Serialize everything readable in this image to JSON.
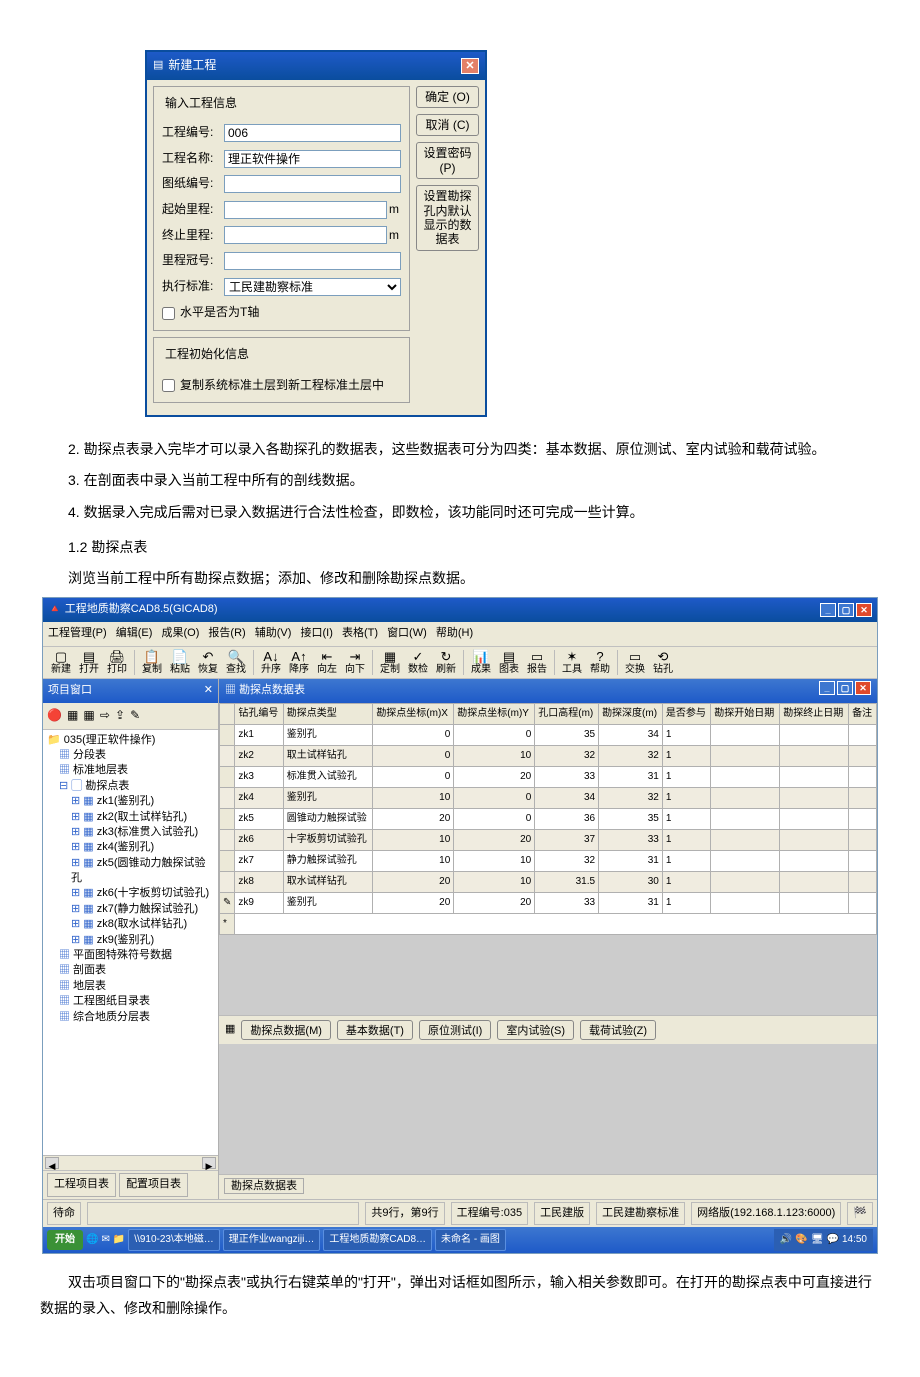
{
  "dialog1": {
    "title": "新建工程",
    "fs1_legend": "输入工程信息",
    "lbl_projId": "工程编号:",
    "val_projId": "006",
    "lbl_projName": "工程名称:",
    "val_projName": "理正软件操作",
    "lbl_drawId": "图纸编号:",
    "lbl_startMile": "起始里程:",
    "unit_m": "m",
    "lbl_endMile": "终止里程:",
    "lbl_mileCode": "里程冠号:",
    "lbl_standard": "执行标准:",
    "val_standard": "工民建勘察标准",
    "chk_horizT": "水平是否为T轴",
    "fs2_legend": "工程初始化信息",
    "chk_copyStd": "复制系统标准土层到新工程标准土层中",
    "btn_ok": "确定 (O)",
    "btn_cancel": "取消 (C)",
    "btn_pwd": "设置密码 (P)",
    "btn_kktbl": "设置勘探孔内默认显示的数据表"
  },
  "body": {
    "p2": "2. 勘探点表录入完毕才可以录入各勘探孔的数据表，这些数据表可分为四类：基本数据、原位测试、室内试验和载荷试验。",
    "p3": "3. 在剖面表中录入当前工程中所有的剖线数据。",
    "p4": "4. 数据录入完成后需对已录入数据进行合法性检查，即数检，该功能同时还可完成一些计算。",
    "h12": "1.2 勘探点表",
    "p_browse": "浏览当前工程中所有勘探点数据；添加、修改和删除勘探点数据。",
    "p_last": "双击项目窗口下的\"勘探点表\"或执行右键菜单的\"打开\"，弹出对话框如图所示，输入相关参数即可。在打开的勘探点表中可直接进行数据的录入、修改和删除操作。"
  },
  "s2": {
    "apptitle": "工程地质勘察CAD8.5(GICAD8)",
    "menu": {
      "m1": "工程管理(P)",
      "m2": "编辑(E)",
      "m3": "成果(O)",
      "m4": "报告(R)",
      "m5": "辅助(V)",
      "m6": "接口(I)",
      "m7": "表格(T)",
      "m8": "窗口(W)",
      "m9": "帮助(H)"
    },
    "toolbar": [
      {
        "ic": "▢",
        "t": "新建"
      },
      {
        "ic": "▤",
        "t": "打开"
      },
      {
        "ic": "🖨",
        "t": "打印"
      },
      {
        "ic": "📋",
        "t": "复制"
      },
      {
        "ic": "📄",
        "t": "粘贴"
      },
      {
        "ic": "↶",
        "t": "恢复"
      },
      {
        "ic": "🔍",
        "t": "查找"
      },
      {
        "ic": "A↓",
        "t": "升序"
      },
      {
        "ic": "A↑",
        "t": "降序"
      },
      {
        "ic": "⇤",
        "t": "向左"
      },
      {
        "ic": "⇥",
        "t": "向下"
      },
      {
        "ic": "▦",
        "t": "定制"
      },
      {
        "ic": "✓",
        "t": "数检"
      },
      {
        "ic": "↻",
        "t": "刷新"
      },
      {
        "ic": "📊",
        "t": "成果"
      },
      {
        "ic": "▤",
        "t": "图表"
      },
      {
        "ic": "▭",
        "t": "报告"
      },
      {
        "ic": "✶",
        "t": "工具"
      },
      {
        "ic": "?",
        "t": "帮助"
      },
      {
        "ic": "▭",
        "t": "交换"
      },
      {
        "ic": "⟲",
        "t": "钻孔"
      }
    ],
    "side_title": "项目窗口",
    "tree_root": "035(理正软件操作)",
    "tree": [
      {
        "ic": "▦",
        "t": "分段表",
        "lvl": 1
      },
      {
        "ic": "▦",
        "t": "标准地层表",
        "lvl": 1
      },
      {
        "ic": "▢",
        "t": "勘探点表",
        "lvl": 1,
        "exp": "⊟"
      },
      {
        "ic": "▦",
        "t": "zk1(鉴别孔)",
        "lvl": 2,
        "exp": "⊞"
      },
      {
        "ic": "▦",
        "t": "zk2(取土试样钻孔)",
        "lvl": 2,
        "exp": "⊞"
      },
      {
        "ic": "▦",
        "t": "zk3(标准贯入试验孔)",
        "lvl": 2,
        "exp": "⊞"
      },
      {
        "ic": "▦",
        "t": "zk4(鉴别孔)",
        "lvl": 2,
        "exp": "⊞"
      },
      {
        "ic": "▦",
        "t": "zk5(圆锥动力触探试验孔",
        "lvl": 2,
        "exp": "⊞"
      },
      {
        "ic": "▦",
        "t": "zk6(十字板剪切试验孔)",
        "lvl": 2,
        "exp": "⊞"
      },
      {
        "ic": "▦",
        "t": "zk7(静力触探试验孔)",
        "lvl": 2,
        "exp": "⊞"
      },
      {
        "ic": "▦",
        "t": "zk8(取水试样钻孔)",
        "lvl": 2,
        "exp": "⊞"
      },
      {
        "ic": "▦",
        "t": "zk9(鉴别孔)",
        "lvl": 2,
        "exp": "⊞"
      },
      {
        "ic": "▦",
        "t": "平面图特殊符号数据",
        "lvl": 1
      },
      {
        "ic": "▦",
        "t": "剖面表",
        "lvl": 1
      },
      {
        "ic": "▦",
        "t": "地层表",
        "lvl": 1
      },
      {
        "ic": "▦",
        "t": "工程图纸目录表",
        "lvl": 1
      },
      {
        "ic": "▦",
        "t": "综合地质分层表",
        "lvl": 1
      }
    ],
    "side_tab1": "工程项目表",
    "side_tab2": "配置项目表",
    "right_title": "勘探点数据表",
    "cols": {
      "c1": "钻孔编号",
      "c2": "勘探点类型",
      "c3": "勘探点坐标(m)X",
      "c4": "勘探点坐标(m)Y",
      "c5": "孔口高程(m)",
      "c6": "勘探深度(m)",
      "c7": "是否参与",
      "c8": "勘探开始日期",
      "c9": "勘探终止日期",
      "c10": "备注"
    },
    "rows": [
      {
        "id": "zk1",
        "type": "鉴别孔",
        "x": "0",
        "y": "0",
        "z": "35",
        "d": "34",
        "p": "1"
      },
      {
        "id": "zk2",
        "type": "取土试样钻孔",
        "x": "0",
        "y": "10",
        "z": "32",
        "d": "32",
        "p": "1"
      },
      {
        "id": "zk3",
        "type": "标准贯入试验孔",
        "x": "0",
        "y": "20",
        "z": "33",
        "d": "31",
        "p": "1"
      },
      {
        "id": "zk4",
        "type": "鉴别孔",
        "x": "10",
        "y": "0",
        "z": "34",
        "d": "32",
        "p": "1"
      },
      {
        "id": "zk5",
        "type": "圆锥动力触探试验",
        "x": "20",
        "y": "0",
        "z": "36",
        "d": "35",
        "p": "1"
      },
      {
        "id": "zk6",
        "type": "十字板剪切试验孔",
        "x": "10",
        "y": "20",
        "z": "37",
        "d": "33",
        "p": "1"
      },
      {
        "id": "zk7",
        "type": "静力触探试验孔",
        "x": "10",
        "y": "10",
        "z": "32",
        "d": "31",
        "p": "1"
      },
      {
        "id": "zk8",
        "type": "取水试样钻孔",
        "x": "20",
        "y": "10",
        "z": "31.5",
        "d": "30",
        "p": "1"
      },
      {
        "id": "zk9",
        "type": "鉴别孔",
        "x": "20",
        "y": "20",
        "z": "33",
        "d": "31",
        "p": "1"
      }
    ],
    "btn_row": {
      "b1": "勘探点数据(M)",
      "b2": "基本数据(T)",
      "b3": "原位测试(I)",
      "b4": "室内试验(S)",
      "b5": "载荷试验(Z)"
    },
    "sheet_tab": "勘探点数据表",
    "status": {
      "s0": "待命",
      "s1": "共9行，第9行",
      "s2": "工程编号:035",
      "s3": "工民建版",
      "s4": "工民建勘察标准",
      "s5": "网络版(192.168.1.123:6000)"
    },
    "taskbar": {
      "start": "开始",
      "t1": "\\\\910-23\\本地磁…",
      "t2": "理正作业wangziji…",
      "t3": "工程地质勘察CAD8…",
      "t4": "未命名 - 画图",
      "time": "14:50"
    }
  }
}
